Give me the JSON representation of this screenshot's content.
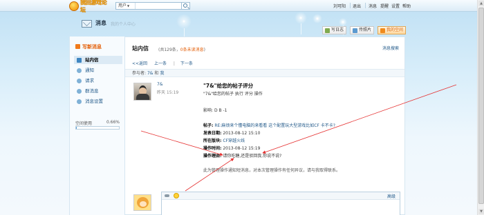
{
  "topbar": {
    "logo_text": "我回游戏论坛",
    "search_scope": "用户",
    "links": [
      "刘可阳",
      "退出",
      "消息",
      "提醒",
      "设置",
      "帮助"
    ]
  },
  "header": {
    "title": "消息",
    "subtitle": "我的个人中心"
  },
  "actions": [
    {
      "label": "写日志",
      "icon": "edit-icon"
    },
    {
      "label": "传照片",
      "icon": "photo-icon"
    },
    {
      "label": "我的空间",
      "icon": "home-icon"
    }
  ],
  "sidebar": {
    "write_label": "写新消息",
    "items": [
      {
        "label": "站内信",
        "icon": "mail-icon"
      },
      {
        "label": "通知",
        "icon": "bell-icon"
      },
      {
        "label": "请求",
        "icon": "request-icon"
      },
      {
        "label": "群消息",
        "icon": "group-icon"
      },
      {
        "label": "消息设置",
        "icon": "gear-icon"
      }
    ],
    "space_label": "空间使用",
    "space_pct": "0.66%",
    "space_fraction": 0.0066
  },
  "main": {
    "title": "站内信",
    "count_prefix": "(共129条，",
    "count_unread": "0条未读消息",
    "count_suffix": ")",
    "setting_link": "消息搜索",
    "pager": {
      "back": "<<返回",
      "prev": "上一条",
      "next": "下一条"
    },
    "participants_label": "参与者:",
    "participant_1": "7&",
    "participant_and": "和",
    "participant_2": "我"
  },
  "message": {
    "sender": "7&",
    "time": "昨天 15:19",
    "subject": "\"7&\"给您的帖子评分",
    "line1": "\"7&\"给您的帖子 执行 评分 操作",
    "rating_label": "影响:",
    "rating_value": "D B -1",
    "post_label": "帖子:",
    "post_value": "RE:麻烦来个懂电脑的来看看 这个配置玩大型游戏比如CF 卡不卡?",
    "date_label": "发表日期:",
    "date_value": "2013-08-12 15:10",
    "forum_label": "所在版块:",
    "forum_value": "CF穿越火线",
    "optime_label": "操作时间:",
    "optime_value": "2013-08-12 15:19",
    "reason_label": "操作理由:",
    "reason_value": "请你吃糖,还是驳回我,你说不说?",
    "footer": "此为管理操作通知短消息，对本次管理操作有任何异议，请与我取得联系。"
  },
  "reply": {
    "advanced_label": "高级"
  },
  "colors": {
    "accent": "#e35a00",
    "link": "#235a8a",
    "arrow": "#e53030"
  }
}
